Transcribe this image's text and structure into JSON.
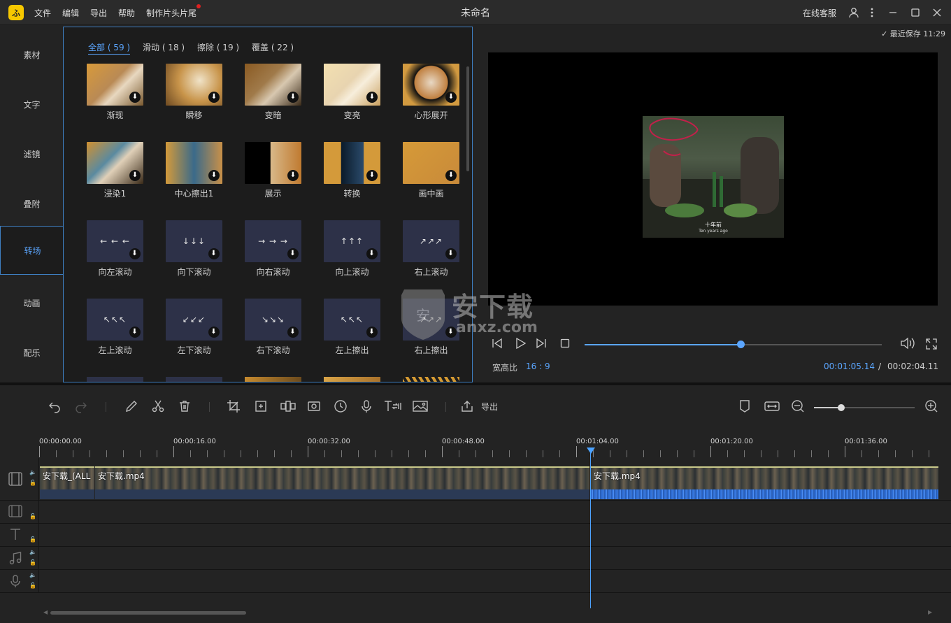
{
  "app": {
    "logo_text": "ふ",
    "title": "未命名",
    "menu": [
      "文件",
      "编辑",
      "导出",
      "帮助",
      "制作片头片尾"
    ],
    "support": "在线客服"
  },
  "left_tabs": [
    {
      "label": "素材",
      "active": false
    },
    {
      "label": "文字",
      "active": false
    },
    {
      "label": "滤镜",
      "active": false
    },
    {
      "label": "叠附",
      "active": false
    },
    {
      "label": "转场",
      "active": true
    },
    {
      "label": "动画",
      "active": false
    },
    {
      "label": "配乐",
      "active": false
    }
  ],
  "filter_tabs": [
    {
      "label": "全部 ( 59 )",
      "active": true
    },
    {
      "label": "滑动 ( 18 )",
      "active": false
    },
    {
      "label": "擦除 ( 19 )",
      "active": false
    },
    {
      "label": "覆盖 ( 22 )",
      "active": false
    }
  ],
  "transitions": [
    {
      "label": "渐现",
      "kind": "photo"
    },
    {
      "label": "瞬移",
      "kind": "photo"
    },
    {
      "label": "变暗",
      "kind": "photo"
    },
    {
      "label": "变亮",
      "kind": "photo"
    },
    {
      "label": "心形展开",
      "kind": "photo"
    },
    {
      "label": "浸染1",
      "kind": "photo"
    },
    {
      "label": "中心擦出1",
      "kind": "photo"
    },
    {
      "label": "展示",
      "kind": "photo"
    },
    {
      "label": "转换",
      "kind": "photo"
    },
    {
      "label": "画中画",
      "kind": "photo"
    },
    {
      "label": "向左滚动",
      "kind": "arrow",
      "glyph": "← ← ←"
    },
    {
      "label": "向下滚动",
      "kind": "arrow",
      "glyph": "↓↓↓"
    },
    {
      "label": "向右滚动",
      "kind": "arrow",
      "glyph": "→ → →"
    },
    {
      "label": "向上滚动",
      "kind": "arrow",
      "glyph": "↑↑↑"
    },
    {
      "label": "右上滚动",
      "kind": "arrow",
      "glyph": "↗↗↗"
    },
    {
      "label": "左上滚动",
      "kind": "arrow",
      "glyph": "↖↖↖"
    },
    {
      "label": "左下滚动",
      "kind": "arrow",
      "glyph": "↙↙↙"
    },
    {
      "label": "右下滚动",
      "kind": "arrow",
      "glyph": "↘↘↘"
    },
    {
      "label": "左上擦出",
      "kind": "arrow",
      "glyph": "↖↖↖"
    },
    {
      "label": "右上擦出",
      "kind": "arrow",
      "glyph": "↗↗↗"
    }
  ],
  "preview": {
    "saved": "最近保存 11:29",
    "subtitle_cn": "十年前",
    "subtitle_en": "Ten years ago",
    "aspect_label": "宽高比",
    "aspect_value": "16 : 9",
    "current_time": "00:01:05.14",
    "separator": "/",
    "total_time": "00:02:04.11",
    "progress": 0.527
  },
  "toolbar": {
    "export_label": "导出"
  },
  "ruler": [
    "00:00:00.00",
    "00:00:16.00",
    "00:00:32.00",
    "00:00:48.00",
    "00:01:04.00",
    "00:01:20.00",
    "00:01:36.00"
  ],
  "clips": [
    "安下载_(ALL",
    "安下载.mp4",
    "安下载.mp4"
  ],
  "watermark": {
    "main": "安下载",
    "sub": "anxz.com"
  },
  "colors": {
    "accent": "#5ba6ff",
    "panel": "#1c1c1c",
    "background": "#232323",
    "tile_bg": "#2d3148"
  }
}
